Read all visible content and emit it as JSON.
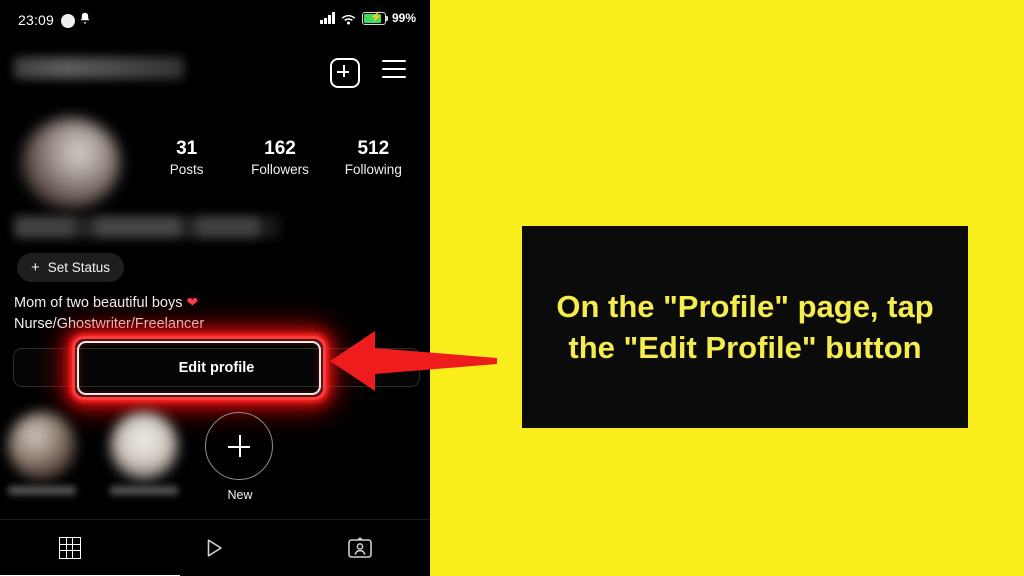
{
  "colors": {
    "background_yellow": "#f9ed1c",
    "callout_background": "#0b0b0b",
    "callout_text": "#f5ec4e",
    "highlight_red": "#ff3a3a",
    "arrow_red": "#ee1c1c",
    "phone_background": "#000000",
    "battery_green": "#3ddc5b"
  },
  "phone": {
    "status_bar": {
      "time": "23:09",
      "notification_dot": "notification-dot",
      "bell_icon": "ὑ4",
      "signal_icon": "signal-bars-icon",
      "wifi_icon": "wifi-icon",
      "battery_icon": "battery-charging-icon",
      "battery_percent": "99%"
    },
    "header": {
      "username": "",
      "username_state": "blurred",
      "new_post_icon": "plus-square-icon",
      "menu_icon": "hamburger-menu-icon"
    },
    "profile": {
      "avatar": "profile-avatar",
      "avatar_state": "blurred",
      "display_name": "",
      "display_name_state": "blurred",
      "stats": [
        {
          "number": "31",
          "label": "Posts"
        },
        {
          "number": "162",
          "label": "Followers"
        },
        {
          "number": "512",
          "label": "Following"
        }
      ],
      "set_status": {
        "plus": "+",
        "label": "Set Status"
      },
      "bio": [
        "Mom of two beautiful boys",
        "Nurse/Ghostwriter/Freelancer"
      ],
      "bio_emoji": "❤",
      "edit_profile_label": "Edit profile"
    },
    "highlights": [
      {
        "label": "",
        "label_state": "blurred"
      },
      {
        "label": "",
        "label_state": "blurred"
      }
    ],
    "new_highlight": {
      "plus": "+",
      "label": "New"
    },
    "tab_bar": {
      "tabs": [
        {
          "icon": "grid-icon",
          "name": "posts-grid",
          "active": true
        },
        {
          "icon": "play-triangle-icon",
          "name": "reels",
          "active": false
        },
        {
          "icon": "tagged-person-icon",
          "name": "tagged",
          "active": false
        }
      ]
    }
  },
  "annotation": {
    "arrow": "left-pointing-arrow",
    "instruction": "On the \"Profile\" page, tap the \"Edit Profile\" button",
    "highlight_target": "Edit profile"
  }
}
